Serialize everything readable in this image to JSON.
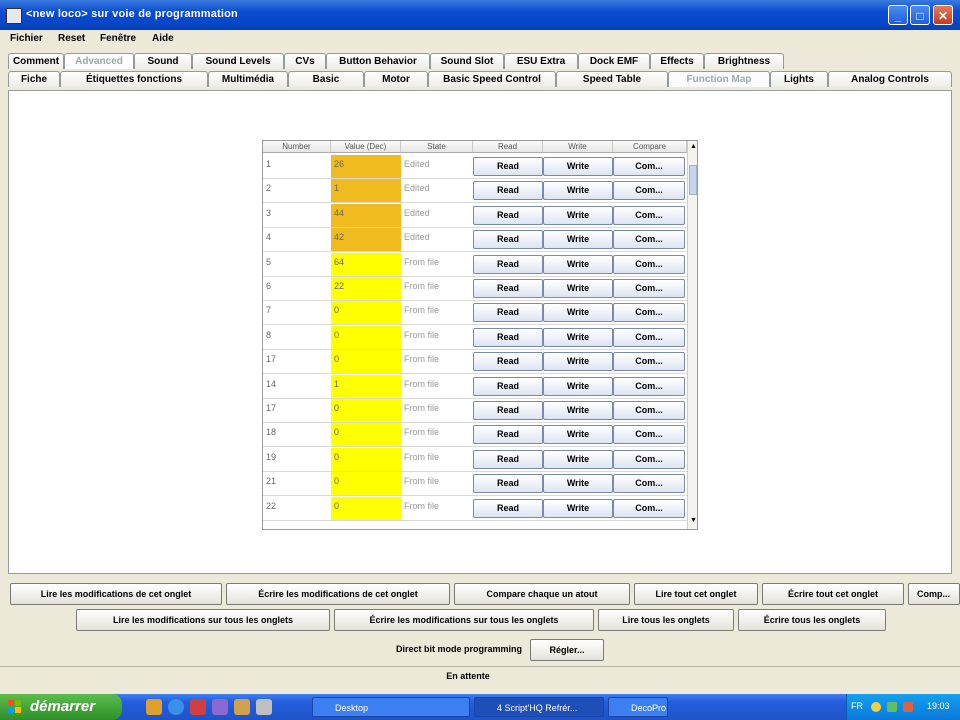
{
  "window": {
    "title": "<new loco> sur voie de programmation",
    "controls": [
      "minimize",
      "maximize",
      "close"
    ]
  },
  "menubar": [
    "Fichier",
    "Reset",
    "Fenêtre",
    "Aide"
  ],
  "tabs_row1": [
    {
      "label": "Comment"
    },
    {
      "label": "Advanced",
      "selected": true
    },
    {
      "label": "Sound"
    },
    {
      "label": "Sound Levels"
    },
    {
      "label": "CVs"
    },
    {
      "label": "Button Behavior"
    },
    {
      "label": "Sound Slot"
    },
    {
      "label": "ESU Extra"
    },
    {
      "label": "Dock EMF"
    },
    {
      "label": "Effects"
    },
    {
      "label": "Brightness"
    }
  ],
  "tabs_row2": [
    {
      "label": "Fiche"
    },
    {
      "label": "Étiquettes fonctions"
    },
    {
      "label": "Multimédia"
    },
    {
      "label": "Basic"
    },
    {
      "label": "Motor"
    },
    {
      "label": "Basic Speed Control"
    },
    {
      "label": "Speed Table"
    },
    {
      "label": "Function Map",
      "selected": true
    },
    {
      "label": "Lights"
    },
    {
      "label": "Analog Controls"
    }
  ],
  "cv_table": {
    "headers": [
      "Number",
      "Value (Dec)",
      "State",
      "Read",
      "Write",
      "Compare"
    ],
    "buttons": {
      "read": "Read",
      "write": "Write",
      "compare": "Com..."
    },
    "rows": [
      {
        "number": "1",
        "value": "26",
        "state": "Edited",
        "kind": "edited"
      },
      {
        "number": "2",
        "value": "1",
        "state": "Edited",
        "kind": "edited"
      },
      {
        "number": "3",
        "value": "44",
        "state": "Edited",
        "kind": "edited"
      },
      {
        "number": "4",
        "value": "42",
        "state": "Edited",
        "kind": "edited"
      },
      {
        "number": "5",
        "value": "64",
        "state": "From file",
        "kind": "fromfile"
      },
      {
        "number": "6",
        "value": "22",
        "state": "From file",
        "kind": "fromfile"
      },
      {
        "number": "7",
        "value": "0",
        "state": "From file",
        "kind": "fromfile"
      },
      {
        "number": "8",
        "value": "0",
        "state": "From file",
        "kind": "fromfile"
      },
      {
        "number": "17",
        "value": "0",
        "state": "From file",
        "kind": "fromfile"
      },
      {
        "number": "14",
        "value": "1",
        "state": "From file",
        "kind": "fromfile"
      },
      {
        "number": "17",
        "value": "0",
        "state": "From file",
        "kind": "fromfile"
      },
      {
        "number": "18",
        "value": "0",
        "state": "From file",
        "kind": "fromfile"
      },
      {
        "number": "19",
        "value": "0",
        "state": "From file",
        "kind": "fromfile"
      },
      {
        "number": "21",
        "value": "0",
        "state": "From file",
        "kind": "fromfile"
      },
      {
        "number": "22",
        "value": "0",
        "state": "From file",
        "kind": "fromfile"
      }
    ]
  },
  "actions_row1": [
    "Lire les modifications de cet onglet",
    "Écrire les modifications de cet onglet",
    "Compare chaque un atout",
    "Lire tout cet onglet",
    "Écrire tout cet onglet",
    "Comp..."
  ],
  "actions_row2": [
    "Lire les modifications sur tous les onglets",
    "Écrire les modifications sur tous les onglets",
    "Lire tous les onglets",
    "Écrire tous les onglets"
  ],
  "mode": {
    "label": "Direct bit mode programming",
    "button": "Régler..."
  },
  "status": "En attente",
  "taskbar": {
    "start": "démarrer",
    "items": [
      "Desktop",
      "4 Script'HQ Refrér...",
      "DecoPro..."
    ],
    "tray_time": "19:03",
    "tray_lang": "FR"
  },
  "colors": {
    "edited": "#f0bb1e",
    "from_file": "#ffff00",
    "titlebar": "#0a4bd0",
    "taskbar": "#245edc",
    "start": "#3c9a34"
  }
}
